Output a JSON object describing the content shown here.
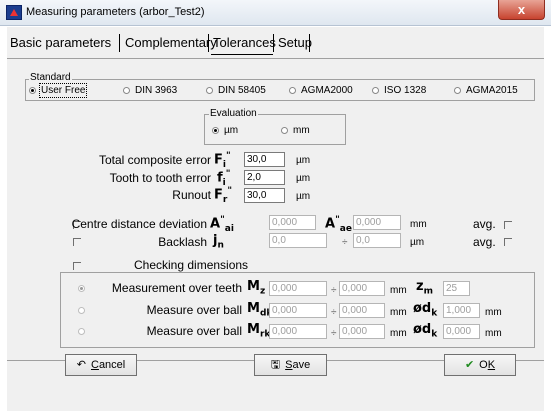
{
  "window": {
    "title": "Measuring parameters  (arbor_Test2)",
    "close_glyph": "x"
  },
  "tabs": [
    {
      "label": "Basic parameters",
      "selected": false
    },
    {
      "label": "Complementary",
      "selected": false
    },
    {
      "label": "Tolerances",
      "selected": true
    },
    {
      "label": "Setup",
      "selected": false
    }
  ],
  "standard": {
    "label": "Standard",
    "options": [
      "User Free",
      "DIN 3963",
      "DIN 58405",
      "AGMA2000",
      "ISO 1328",
      "AGMA2015"
    ],
    "selected": "User Free"
  },
  "evaluation": {
    "label": "Evaluation",
    "options": [
      "µm",
      "mm"
    ],
    "selected": "µm"
  },
  "errors": {
    "total_composite": {
      "label": "Total composite error",
      "symbol": "F",
      "sub": "i",
      "sup": "\"",
      "value": "30,0",
      "unit": "µm"
    },
    "tooth_to_tooth": {
      "label": "Tooth to tooth error",
      "symbol": "f",
      "sub": "i",
      "sup": "\"",
      "value": "2,0",
      "unit": "µm"
    },
    "runout": {
      "label": "Runout",
      "symbol": "F",
      "sub": "r",
      "sup": "\"",
      "value": "30,0",
      "unit": "µm"
    }
  },
  "centre_distance": {
    "label": "Centre distance deviation",
    "sym1": "A",
    "sub1": "ai",
    "sup1": "\"",
    "value1": "0,000",
    "sym2": "A",
    "sub2": "ae",
    "sup2": "\"",
    "value2": "0,000",
    "unit": "mm",
    "avg": "avg."
  },
  "backlash": {
    "label": "Backlash",
    "sym": "j",
    "sub": "n",
    "value1": "0,0",
    "sep": "÷",
    "value2": "0,0",
    "unit": "µm",
    "avg": "avg."
  },
  "checking": {
    "label": "Checking dimensions",
    "rows": [
      {
        "label": "Measurement over teeth",
        "sym": "M",
        "sub": "z",
        "value1": "0,000",
        "sep": "÷",
        "value2": "0,000",
        "unit": "mm",
        "sym2": "z",
        "sub2": "m",
        "value3": "25",
        "unit2": "",
        "selected": true
      },
      {
        "label": "Measure over ball",
        "sym": "M",
        "sub": "dk",
        "value1": "0,000",
        "sep": "÷",
        "value2": "0,000",
        "unit": "mm",
        "sym2": "ød",
        "sub2": "k",
        "value3": "1,000",
        "unit2": "mm",
        "selected": false
      },
      {
        "label": "Measure over ball",
        "sym": "M",
        "sub": "rk",
        "value1": "0,000",
        "sep": "÷",
        "value2": "0,000",
        "unit": "mm",
        "sym2": "ød",
        "sub2": "k",
        "value3": "0,000",
        "unit2": "mm",
        "selected": false
      }
    ]
  },
  "buttons": {
    "cancel": {
      "label": "Cancel",
      "mnemonic": "C",
      "rest": "ancel",
      "icon": "undo-icon",
      "glyph": "↶"
    },
    "save": {
      "label": "Save",
      "mnemonic": "S",
      "rest": "ave",
      "icon": "floppy-icon",
      "glyph": "🖫"
    },
    "ok": {
      "label": "OK",
      "pre": "O",
      "mnemonic": "K",
      "icon": "check-icon",
      "glyph": "✔"
    }
  },
  "colors": {
    "ok_check": "#1f8a1f",
    "titlebar": "#dfe7f0",
    "dialog_bg": "#f0f0f0"
  }
}
